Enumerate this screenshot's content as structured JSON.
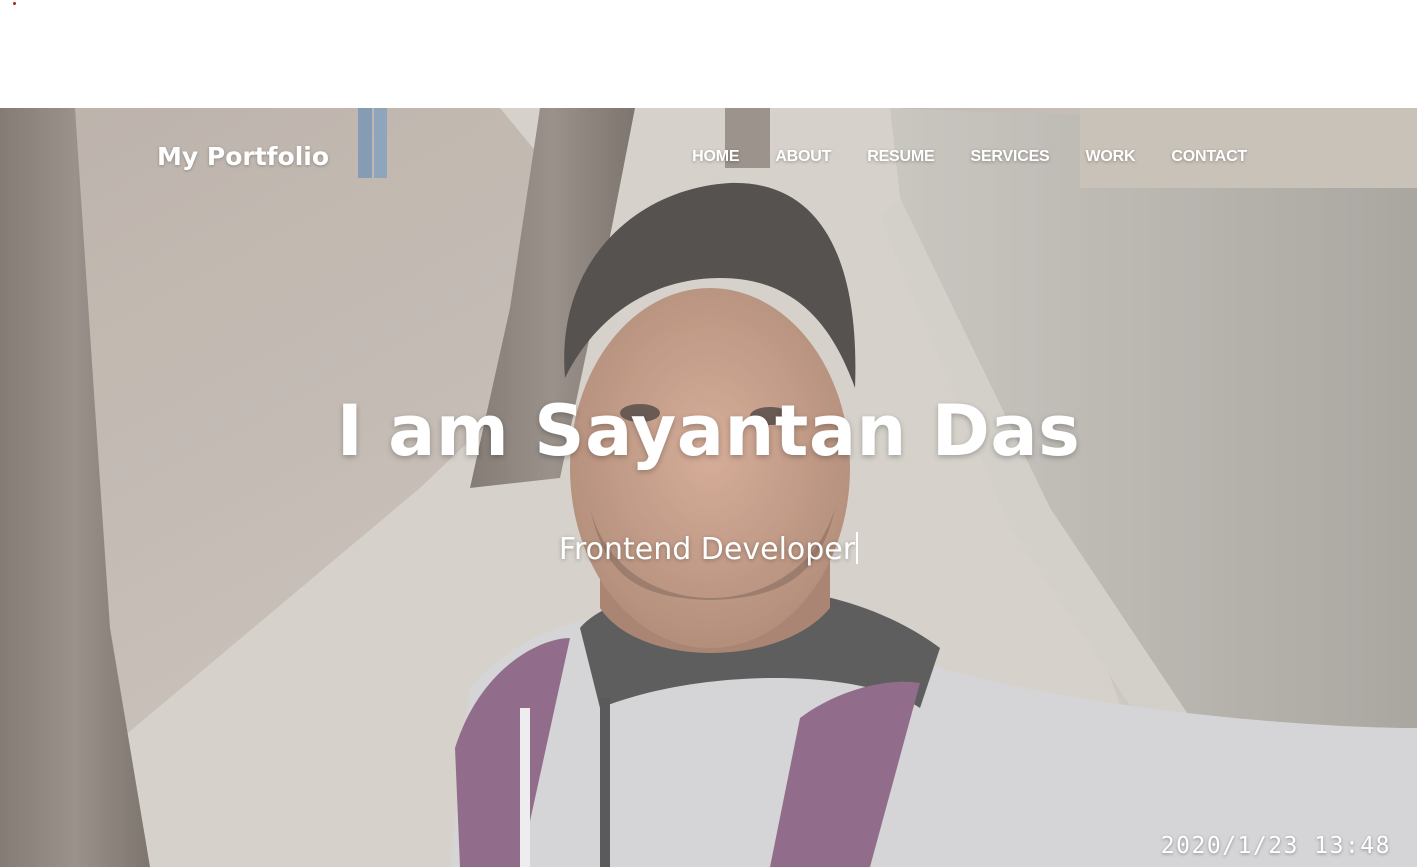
{
  "brand": {
    "title": "My Portfolio"
  },
  "nav": {
    "items": [
      {
        "label": "HOME"
      },
      {
        "label": "ABOUT"
      },
      {
        "label": "RESUME"
      },
      {
        "label": "SERVICES"
      },
      {
        "label": "WORK"
      },
      {
        "label": "CONTACT"
      }
    ]
  },
  "hero": {
    "headline": "I am Sayantan Das",
    "subheadline": "Frontend Developer",
    "photo_timestamp": "2020/1/23  13:48"
  },
  "colors": {
    "text": "#ffffff",
    "sky_ground": "#b7aba1",
    "pavement": "#c9c3bb",
    "wall": "#a9a59c",
    "hoodie": "#c7c7c9",
    "backpack": "#6c3e63"
  }
}
